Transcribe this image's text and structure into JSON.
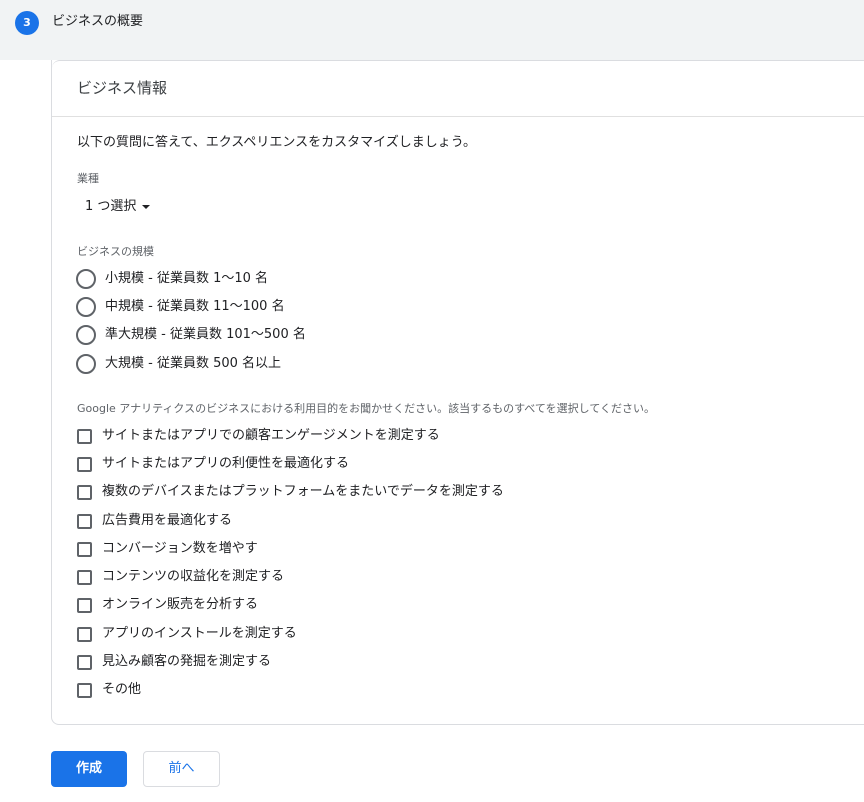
{
  "step": {
    "number": "3",
    "title": "ビジネスの概要"
  },
  "card": {
    "title": "ビジネス情報",
    "intro": "以下の質問に答えて、エクスペリエンスをカスタマイズしましょう。",
    "industry": {
      "label": "業種",
      "selected": "1 つ選択"
    },
    "size": {
      "label": "ビジネスの規模",
      "options": [
        "小規模 - 従業員数 1～10 名",
        "中規模 - 従業員数 11～100 名",
        "準大規模 - 従業員数 101～500 名",
        "大規模 - 従業員数 500 名以上"
      ]
    },
    "usage": {
      "label": "Google アナリティクスのビジネスにおける利用目的をお聞かせください。該当するものすべてを選択してください。",
      "options": [
        "サイトまたはアプリでの顧客エンゲージメントを測定する",
        "サイトまたはアプリの利便性を最適化する",
        "複数のデバイスまたはプラットフォームをまたいでデータを測定する",
        "広告費用を最適化する",
        "コンバージョン数を増やす",
        "コンテンツの収益化を測定する",
        "オンライン販売を分析する",
        "アプリのインストールを測定する",
        "見込み顧客の発掘を測定する",
        "その他"
      ]
    }
  },
  "buttons": {
    "create": "作成",
    "back": "前へ"
  },
  "colors": {
    "accent": "#1a73e8",
    "header_bg": "#f1f3f4",
    "border": "#dadce0"
  }
}
